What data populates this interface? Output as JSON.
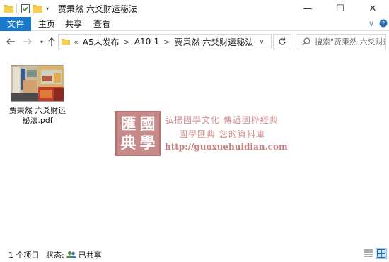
{
  "window": {
    "title": "贾秉然 六爻财运秘法",
    "controls": {
      "minimize": "—",
      "maximize": "☐",
      "close": "✕"
    }
  },
  "ribbon": {
    "tabs": [
      {
        "label": "文件"
      },
      {
        "label": "主页"
      },
      {
        "label": "共享"
      },
      {
        "label": "查看"
      }
    ],
    "accent": "#1979ca"
  },
  "nav": {
    "address": {
      "overflow": "«",
      "crumbs": [
        "A5未发布",
        "A10-1",
        "贾秉然 六爻财运秘法"
      ]
    },
    "search_placeholder": "搜索\"贾秉然 六爻财运..."
  },
  "files": [
    {
      "name": "贾秉然 六爻财运秘法.pdf",
      "type": "pdf"
    }
  ],
  "watermark": {
    "seal": [
      "匯",
      "國",
      "典",
      "學"
    ],
    "line1": "弘揚國學文化  傳遞國粹經典",
    "line2": "國學匯典 您的資料庫",
    "url": "http://guoxuehuidian.com"
  },
  "status": {
    "count": "1 个项目",
    "state_label": "状态:",
    "state_value": "已共享"
  }
}
